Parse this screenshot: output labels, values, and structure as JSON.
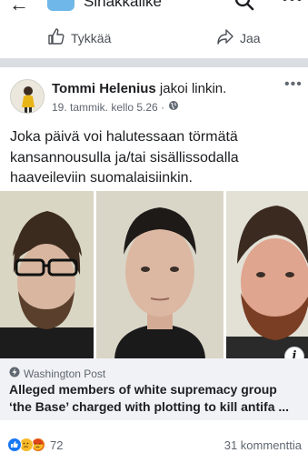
{
  "topbar": {
    "title": "Sinakkalike"
  },
  "actions": {
    "like_label": "Tykkää",
    "share_label": "Jaa"
  },
  "post": {
    "author": "Tommi Helenius",
    "verb": "jakoi linkin.",
    "timestamp": "19. tammik. kello 5.26 ·",
    "text": "Joka päivä voi halutessaan törmätä kansannousulla ja/tai sisällissodalla haaveileviin suomalaisiinkin."
  },
  "link": {
    "source": "Washington Post",
    "headline_line1": "Alleged members of white supremacy group",
    "headline_line2": "‘the Base’ charged with plotting to kill antifa ..."
  },
  "footer": {
    "reaction_count": "72",
    "comments": "31 kommenttia"
  },
  "colors": {
    "like_blue": "#1877f2",
    "card_bg": "#f0f2f5",
    "separator": "#dadde1"
  },
  "icons": [
    "back-arrow-icon",
    "search-icon",
    "more-icon",
    "thumbs-up-icon",
    "share-arrow-icon",
    "globe-icon",
    "info-icon",
    "bolt-icon",
    "like-reaction-icon",
    "sad-reaction-icon",
    "angry-reaction-icon"
  ]
}
